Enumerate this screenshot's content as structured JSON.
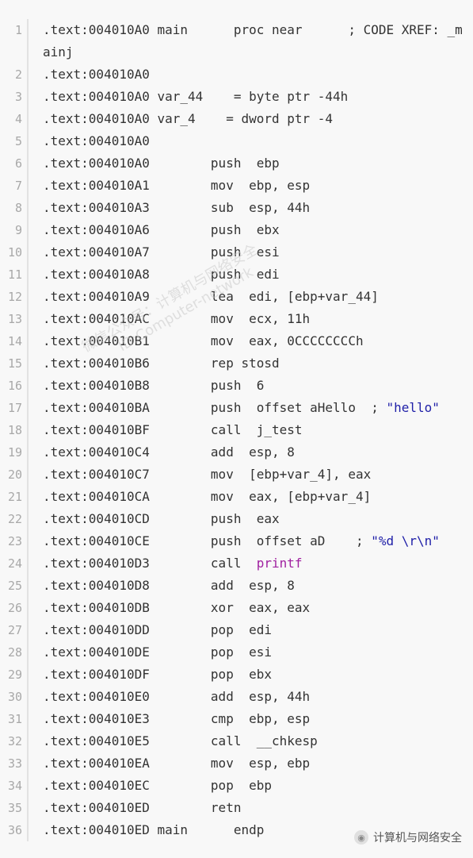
{
  "code": {
    "lines": [
      {
        "n": "1",
        "segments": [
          {
            "t": ".text:004010A0 main      proc near      ; CODE XREF: _mainj",
            "c": "plain"
          }
        ]
      },
      {
        "n": "2",
        "segments": [
          {
            "t": ".text:004010A0",
            "c": "plain"
          }
        ]
      },
      {
        "n": "3",
        "segments": [
          {
            "t": ".text:004010A0 var_44    = byte ptr -44h",
            "c": "plain"
          }
        ]
      },
      {
        "n": "4",
        "segments": [
          {
            "t": ".text:004010A0 var_4    = dword ptr -4",
            "c": "plain"
          }
        ]
      },
      {
        "n": "5",
        "segments": [
          {
            "t": ".text:004010A0",
            "c": "plain"
          }
        ]
      },
      {
        "n": "6",
        "segments": [
          {
            "t": ".text:004010A0        push  ebp",
            "c": "plain"
          }
        ]
      },
      {
        "n": "7",
        "segments": [
          {
            "t": ".text:004010A1        mov  ebp, esp",
            "c": "plain"
          }
        ]
      },
      {
        "n": "8",
        "segments": [
          {
            "t": ".text:004010A3        sub  esp, 44h",
            "c": "plain"
          }
        ]
      },
      {
        "n": "9",
        "segments": [
          {
            "t": ".text:004010A6        push  ebx",
            "c": "plain"
          }
        ]
      },
      {
        "n": "10",
        "segments": [
          {
            "t": ".text:004010A7        push  esi",
            "c": "plain"
          }
        ]
      },
      {
        "n": "11",
        "segments": [
          {
            "t": ".text:004010A8        push  edi",
            "c": "plain"
          }
        ]
      },
      {
        "n": "12",
        "segments": [
          {
            "t": ".text:004010A9        lea  edi, [ebp+var_44]",
            "c": "plain"
          }
        ]
      },
      {
        "n": "13",
        "segments": [
          {
            "t": ".text:004010AC        mov  ecx, 11h",
            "c": "plain"
          }
        ]
      },
      {
        "n": "14",
        "segments": [
          {
            "t": ".text:004010B1        mov  eax, 0CCCCCCCCh",
            "c": "plain"
          }
        ]
      },
      {
        "n": "15",
        "segments": [
          {
            "t": ".text:004010B6        rep stosd",
            "c": "plain"
          }
        ]
      },
      {
        "n": "16",
        "segments": [
          {
            "t": ".text:004010B8        push  6",
            "c": "plain"
          }
        ]
      },
      {
        "n": "17",
        "segments": [
          {
            "t": ".text:004010BA        push  offset aHello  ; ",
            "c": "plain"
          },
          {
            "t": "\"hello\"",
            "c": "str"
          }
        ]
      },
      {
        "n": "18",
        "segments": [
          {
            "t": ".text:004010BF        call  j_test",
            "c": "plain"
          }
        ]
      },
      {
        "n": "19",
        "segments": [
          {
            "t": ".text:004010C4        add  esp, 8",
            "c": "plain"
          }
        ]
      },
      {
        "n": "20",
        "segments": [
          {
            "t": ".text:004010C7        mov  [ebp+var_4], eax",
            "c": "plain"
          }
        ]
      },
      {
        "n": "21",
        "segments": [
          {
            "t": ".text:004010CA        mov  eax, [ebp+var_4]",
            "c": "plain"
          }
        ]
      },
      {
        "n": "22",
        "segments": [
          {
            "t": ".text:004010CD        push  eax",
            "c": "plain"
          }
        ]
      },
      {
        "n": "23",
        "segments": [
          {
            "t": ".text:004010CE        push  offset aD    ; ",
            "c": "plain"
          },
          {
            "t": "\"%d \\r\\n\"",
            "c": "str"
          }
        ]
      },
      {
        "n": "24",
        "segments": [
          {
            "t": ".text:004010D3        call  ",
            "c": "plain"
          },
          {
            "t": "printf",
            "c": "fn"
          }
        ]
      },
      {
        "n": "25",
        "segments": [
          {
            "t": ".text:004010D8        add  esp, 8",
            "c": "plain"
          }
        ]
      },
      {
        "n": "26",
        "segments": [
          {
            "t": ".text:004010DB        xor  eax, eax",
            "c": "plain"
          }
        ]
      },
      {
        "n": "27",
        "segments": [
          {
            "t": ".text:004010DD        pop  edi",
            "c": "plain"
          }
        ]
      },
      {
        "n": "28",
        "segments": [
          {
            "t": ".text:004010DE        pop  esi",
            "c": "plain"
          }
        ]
      },
      {
        "n": "29",
        "segments": [
          {
            "t": ".text:004010DF        pop  ebx",
            "c": "plain"
          }
        ]
      },
      {
        "n": "30",
        "segments": [
          {
            "t": ".text:004010E0        add  esp, 44h",
            "c": "plain"
          }
        ]
      },
      {
        "n": "31",
        "segments": [
          {
            "t": ".text:004010E3        cmp  ebp, esp",
            "c": "plain"
          }
        ]
      },
      {
        "n": "32",
        "segments": [
          {
            "t": ".text:004010E5        call  __chkesp",
            "c": "plain"
          }
        ]
      },
      {
        "n": "33",
        "segments": [
          {
            "t": ".text:004010EA        mov  esp, ebp",
            "c": "plain"
          }
        ]
      },
      {
        "n": "34",
        "segments": [
          {
            "t": ".text:004010EC        pop  ebp",
            "c": "plain"
          }
        ]
      },
      {
        "n": "35",
        "segments": [
          {
            "t": ".text:004010ED        retn",
            "c": "plain"
          }
        ]
      },
      {
        "n": "36",
        "segments": [
          {
            "t": ".text:004010ED main      endp",
            "c": "plain"
          }
        ]
      }
    ]
  },
  "watermark": {
    "line1": "微信公众号：计算机与网络安全",
    "line2": "ID:Computer-network"
  },
  "brand": {
    "icon": "wechat-icon",
    "label": "计算机与网络安全"
  },
  "colors": {
    "string": "#1f1fa8",
    "function": "#a021a0",
    "line_number": "#a8a8a8",
    "text": "#333333"
  }
}
